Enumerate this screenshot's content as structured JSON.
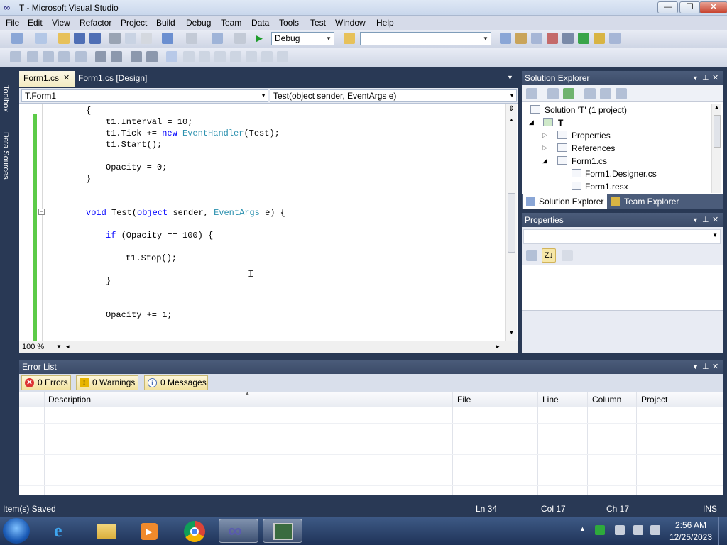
{
  "window": {
    "title": "T - Microsoft Visual Studio",
    "minimize": "—",
    "maximize": "❐",
    "close": "✕"
  },
  "menu": [
    "File",
    "Edit",
    "View",
    "Refactor",
    "Project",
    "Build",
    "Debug",
    "Team",
    "Data",
    "Tools",
    "Test",
    "Window",
    "Help"
  ],
  "toolbar": {
    "config": "Debug",
    "platform": ""
  },
  "side_tabs": {
    "toolbox": "Toolbox",
    "data_sources": "Data Sources"
  },
  "doc_tabs": [
    {
      "label": "Form1.cs",
      "close": "✕"
    },
    {
      "label": "Form1.cs [Design]"
    }
  ],
  "nav": {
    "type": "T.Form1",
    "member": "Test(object sender, EventArgs e)"
  },
  "code": {
    "l1": "{",
    "l2a": "t1.Interval = 10;",
    "l3a": "t1.Tick += ",
    "l3b": "new",
    "l3c": " ",
    "l3d": "EventHandler",
    "l3e": "(Test);",
    "l4": "t1.Start();",
    "l5": "Opacity = 0;",
    "l6": "}",
    "l7a": "void",
    "l7b": " Test(",
    "l7c": "object",
    "l7d": " sender, ",
    "l7e": "EventArgs",
    "l7f": " e) {",
    "l8a": "if",
    "l8b": " (Opacity == 100) {",
    "l9": "t1.Stop();",
    "l10": "}",
    "l11": "Opacity += 1;"
  },
  "zoom": "100 %",
  "solution_explorer": {
    "title": "Solution Explorer",
    "root": "Solution 'T' (1 project)",
    "project": "T",
    "items": [
      "Properties",
      "References",
      "Form1.cs",
      "Form1.Designer.cs",
      "Form1.resx"
    ],
    "tabs": [
      "Solution Explorer",
      "Team Explorer"
    ]
  },
  "properties": {
    "title": "Properties"
  },
  "error_list": {
    "title": "Error List",
    "errors": "0 Errors",
    "warnings": "0 Warnings",
    "messages": "0 Messages",
    "columns": [
      "Description",
      "File",
      "Line",
      "Column",
      "Project"
    ]
  },
  "status": {
    "message": "Item(s) Saved",
    "ln": "Ln 34",
    "col": "Col 17",
    "ch": "Ch 17",
    "mode": "INS"
  },
  "clock": {
    "time": "2:56 AM",
    "date": "12/25/2023"
  },
  "colors": {
    "editor_bg": "#ffffff",
    "chrome": "#293955",
    "changebar": "#5ccb48",
    "keyword": "#0000ff",
    "type": "#2b91af"
  }
}
